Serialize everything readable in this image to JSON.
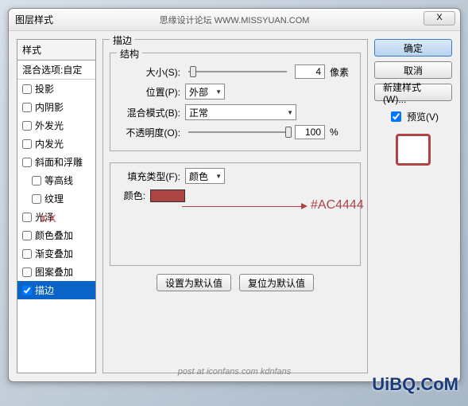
{
  "dialog": {
    "title": "图层样式",
    "center_text": "思缘设计论坛  WWW.MISSYUAN.COM",
    "close": "X"
  },
  "styles_panel": {
    "header": "样式",
    "blend_options": "混合选项:自定",
    "items": [
      {
        "label": "投影",
        "checked": false
      },
      {
        "label": "内阴影",
        "checked": false
      },
      {
        "label": "外发光",
        "checked": false
      },
      {
        "label": "内发光",
        "checked": false
      },
      {
        "label": "斜面和浮雕",
        "checked": false
      },
      {
        "label": "等高线",
        "checked": false,
        "sub": true
      },
      {
        "label": "纹理",
        "checked": false,
        "sub": true
      },
      {
        "label": "光泽",
        "checked": false
      },
      {
        "label": "颜色叠加",
        "checked": false
      },
      {
        "label": "渐变叠加",
        "checked": false
      },
      {
        "label": "图案叠加",
        "checked": false
      },
      {
        "label": "描边",
        "checked": true,
        "selected": true
      }
    ]
  },
  "stroke": {
    "group_label": "描边",
    "structure_label": "结构",
    "size_label": "大小(S):",
    "size_value": "4",
    "size_unit": "像素",
    "position_label": "位置(P):",
    "position_value": "外部",
    "blend_label": "混合模式(B):",
    "blend_value": "正常",
    "opacity_label": "不透明度(O):",
    "opacity_value": "100",
    "opacity_unit": "%",
    "fill_type_label": "填充类型(F):",
    "fill_type_value": "颜色",
    "color_label": "颜色:",
    "color_hex": "#AC4444",
    "set_default": "设置为默认值",
    "reset_default": "复位为默认值"
  },
  "buttons": {
    "ok": "确定",
    "cancel": "取消",
    "new_style": "新建样式(W)...",
    "preview": "预览(V)"
  },
  "footer": "post at iconfans.com  kdnfans",
  "annotation": "#AC4444",
  "watermark_xx": "XX",
  "watermark_br": "UiBQ.CoM"
}
